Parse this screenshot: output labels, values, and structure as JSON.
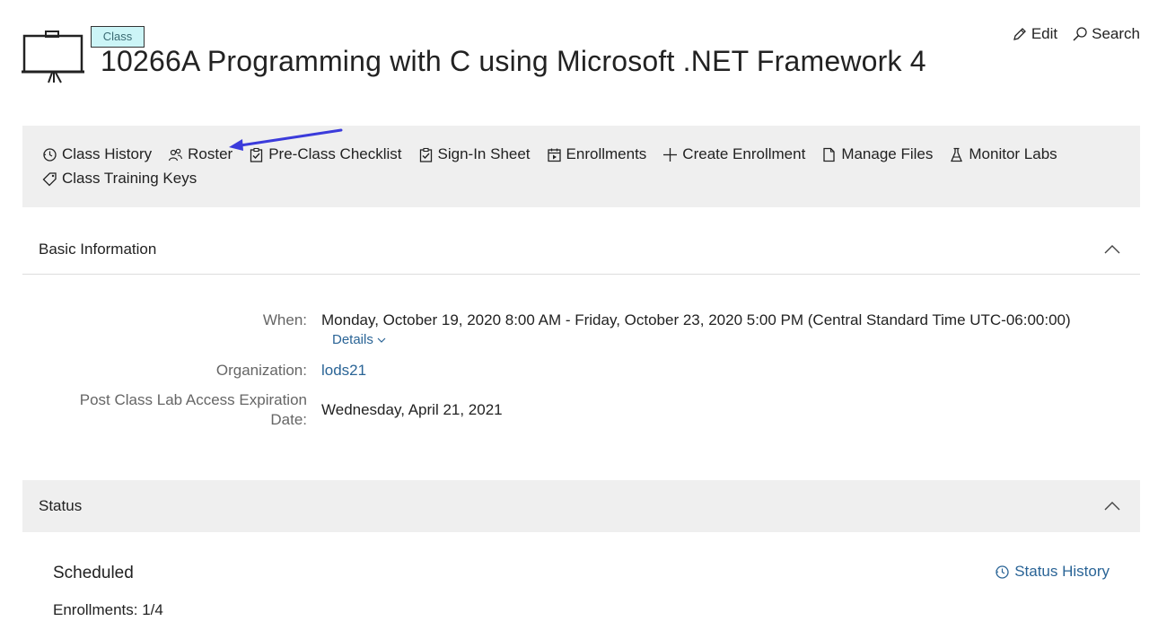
{
  "header": {
    "badge": "Class",
    "title": "10266A Programming with C using Microsoft .NET Framework 4",
    "actions": [
      {
        "label": "Edit",
        "icon": "pencil-icon"
      },
      {
        "label": "Search",
        "icon": "search-icon"
      }
    ]
  },
  "toolbar": {
    "items": [
      {
        "label": "Class History",
        "icon": "history-icon"
      },
      {
        "label": "Roster",
        "icon": "people-icon"
      },
      {
        "label": "Pre-Class Checklist",
        "icon": "clipboard-check-icon"
      },
      {
        "label": "Sign-In Sheet",
        "icon": "clipboard-check-icon"
      },
      {
        "label": "Enrollments",
        "icon": "calendar-icon"
      },
      {
        "label": "Create Enrollment",
        "icon": "plus-icon"
      },
      {
        "label": "Manage Files",
        "icon": "document-icon"
      },
      {
        "label": "Monitor Labs",
        "icon": "flask-icon"
      },
      {
        "label": "Class Training Keys",
        "icon": "tag-icon"
      }
    ]
  },
  "basic_info": {
    "heading": "Basic Information",
    "when_label": "When:",
    "when_value": "Monday, October 19, 2020 8:00 AM - Friday, October 23, 2020 5:00 PM (Central Standard Time UTC-06:00:00)",
    "details_link": "Details",
    "org_label": "Organization:",
    "org_value": "lods21",
    "expiration_label_1": "Post Class Lab Access Expiration",
    "expiration_label_2": "Date:",
    "expiration_value": "Wednesday, April 21, 2021"
  },
  "status": {
    "heading": "Status",
    "state": "Scheduled",
    "enrollments": "Enrollments: 1/4",
    "history_link": "Status History"
  },
  "colors": {
    "toolbar_bg": "#efefef",
    "badge_bg": "#ccf5f7",
    "link": "#2a6496",
    "annotation_arrow": "#3b3bdb"
  }
}
